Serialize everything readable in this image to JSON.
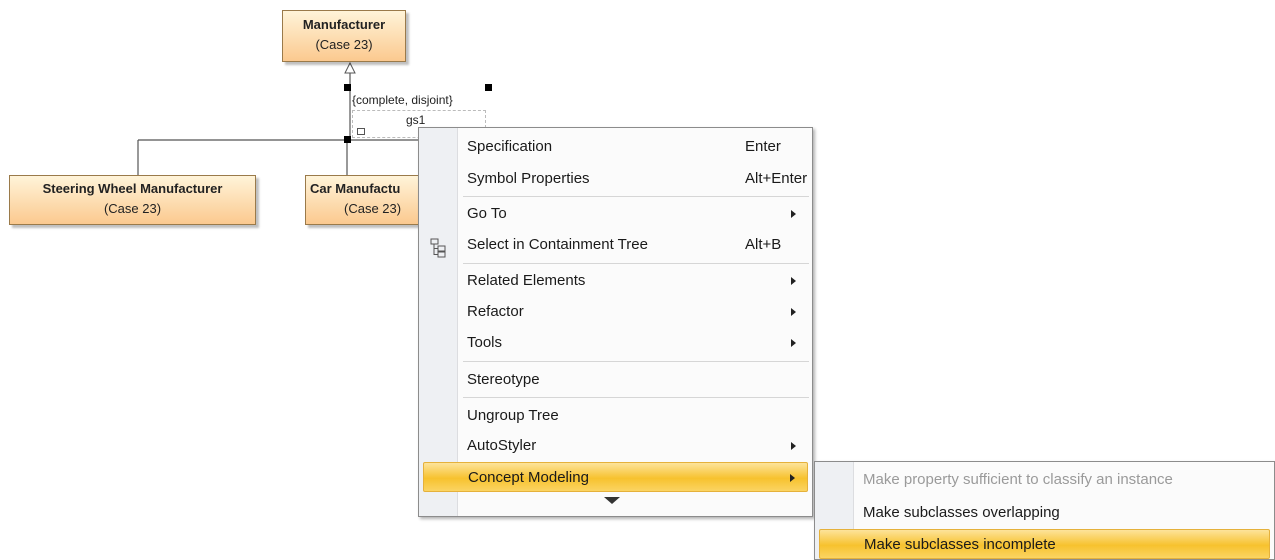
{
  "diagram": {
    "manufacturer": {
      "name": "Manufacturer",
      "case": "(Case 23)"
    },
    "steering": {
      "name": "Steering Wheel Manufacturer",
      "case": "(Case 23)"
    },
    "car": {
      "name": "Car Manufactu",
      "case": "(Case 23)"
    },
    "gs_constraint": "{complete, disjoint}",
    "gs_name": "gs1"
  },
  "context_menu": {
    "specification": {
      "label": "Specification",
      "shortcut": "Enter"
    },
    "symbol_properties": {
      "label": "Symbol Properties",
      "shortcut": "Alt+Enter"
    },
    "go_to": {
      "label": "Go To"
    },
    "select_tree": {
      "label": "Select in Containment Tree",
      "shortcut": "Alt+B"
    },
    "related": {
      "label": "Related Elements"
    },
    "refactor": {
      "label": "Refactor"
    },
    "tools": {
      "label": "Tools"
    },
    "stereotype": {
      "label": "Stereotype"
    },
    "ungroup": {
      "label": "Ungroup Tree"
    },
    "autostyler": {
      "label": "AutoStyler"
    },
    "concept": {
      "label": "Concept Modeling"
    }
  },
  "submenu": {
    "sufficient": "Make property sufficient to classify an instance",
    "overlapping": "Make subclasses overlapping",
    "incomplete": "Make subclasses incomplete"
  },
  "icons": {
    "tree": "containment-tree-icon",
    "submenu": "submenu-arrow-icon",
    "more": "scroll-down-icon"
  },
  "colors": {
    "class_fill_top": "#fff4d9",
    "class_fill_bottom": "#fbc98f",
    "highlight": "#f7c22e"
  }
}
